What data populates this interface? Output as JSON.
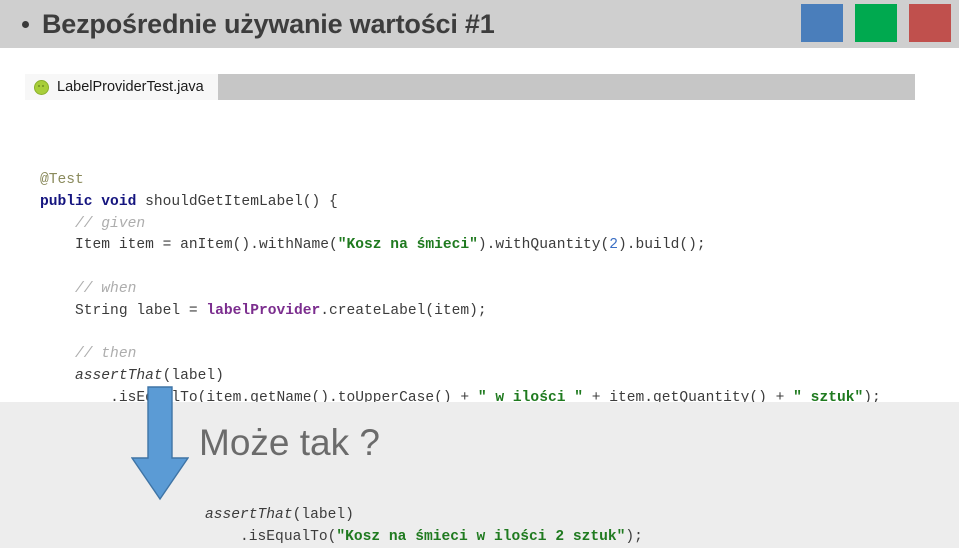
{
  "header": {
    "bullet_icon": "bullet-dot-icon",
    "title": "Bezpośrednie używanie wartości #1",
    "swatches": [
      {
        "name": "blue",
        "color": "#4A7EBB"
      },
      {
        "name": "green",
        "color": "#00A94F"
      },
      {
        "name": "red",
        "color": "#C0504D"
      }
    ]
  },
  "editor": {
    "tab": {
      "icon": "java-class-icon",
      "label": "LabelProviderTest.java"
    },
    "code_lines": [
      {
        "indent": 0,
        "tokens": [
          {
            "t": "anno",
            "v": "@Test"
          }
        ]
      },
      {
        "indent": 0,
        "tokens": [
          {
            "t": "kw",
            "v": "public void"
          },
          {
            "t": "plain",
            "v": " shouldGetItemLabel() {"
          }
        ]
      },
      {
        "indent": 1,
        "tokens": [
          {
            "t": "cmt",
            "v": "// given"
          }
        ]
      },
      {
        "indent": 1,
        "tokens": [
          {
            "t": "plain",
            "v": "Item item = anItem().withName("
          },
          {
            "t": "str",
            "v": "\"Kosz na śmieci\""
          },
          {
            "t": "plain",
            "v": ").withQuantity("
          },
          {
            "t": "num",
            "v": "2"
          },
          {
            "t": "plain",
            "v": ").build();"
          }
        ]
      },
      {
        "indent": 0,
        "tokens": [
          {
            "t": "plain",
            "v": ""
          }
        ]
      },
      {
        "indent": 1,
        "tokens": [
          {
            "t": "cmt",
            "v": "// when"
          }
        ]
      },
      {
        "indent": 1,
        "tokens": [
          {
            "t": "plain",
            "v": "String label = "
          },
          {
            "t": "field",
            "v": "labelProvider"
          },
          {
            "t": "plain",
            "v": ".createLabel(item);"
          }
        ]
      },
      {
        "indent": 0,
        "tokens": [
          {
            "t": "plain",
            "v": ""
          }
        ]
      },
      {
        "indent": 1,
        "tokens": [
          {
            "t": "cmt",
            "v": "// then"
          }
        ]
      },
      {
        "indent": 1,
        "tokens": [
          {
            "t": "static",
            "v": "assertThat"
          },
          {
            "t": "plain",
            "v": "(label)"
          }
        ]
      },
      {
        "indent": 2,
        "tokens": [
          {
            "t": "plain",
            "v": ".isEqualTo(item.getName().toUpperCase() + "
          },
          {
            "t": "str",
            "v": "\" w ilości \""
          },
          {
            "t": "plain",
            "v": " + item.getQuantity() + "
          },
          {
            "t": "str",
            "v": "\" sztuk\""
          },
          {
            "t": "plain",
            "v": ");"
          }
        ]
      },
      {
        "indent": 0,
        "tokens": [
          {
            "t": "plain",
            "v": ""
          }
        ]
      },
      {
        "indent": 0,
        "tokens": [
          {
            "t": "plain",
            "v": "}"
          }
        ]
      }
    ]
  },
  "callout": {
    "arrow_icon": "arrow-down-icon",
    "arrow_color": "#5B9BD5",
    "question": "Może tak ?"
  },
  "bottom_code": {
    "code_lines": [
      {
        "indent": 0,
        "tokens": [
          {
            "t": "static",
            "v": "assertThat"
          },
          {
            "t": "plain",
            "v": "(label)"
          }
        ]
      },
      {
        "indent": 1,
        "tokens": [
          {
            "t": "plain",
            "v": ".isEqualTo("
          },
          {
            "t": "str",
            "v": "\"Kosz na śmieci w ilości 2 sztuk\""
          },
          {
            "t": "plain",
            "v": ");"
          }
        ]
      }
    ]
  }
}
